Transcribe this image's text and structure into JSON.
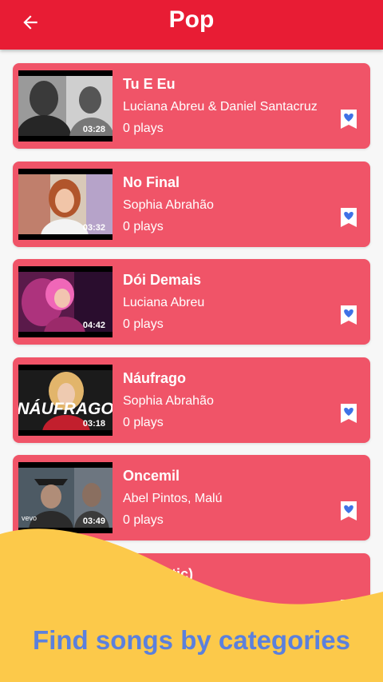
{
  "appbar": {
    "title": "Pop",
    "back_icon": "arrow-left-icon",
    "color": "#e81c34"
  },
  "songs": [
    {
      "title": "Tu E Eu",
      "artist": "Luciana Abreu & Daniel Santacruz",
      "plays": "0 plays",
      "duration": "03:28"
    },
    {
      "title": "No Final",
      "artist": "Sophia Abrahão",
      "plays": "0 plays",
      "duration": "03:32"
    },
    {
      "title": "Dói Demais",
      "artist": "Luciana Abreu",
      "plays": "0 plays",
      "duration": "04:42"
    },
    {
      "title": "Náufrago",
      "artist": "Sophia Abrahão",
      "plays": "0 plays",
      "duration": "03:18",
      "thumb_text": "NÁUFRAGO"
    },
    {
      "title": "Oncemil",
      "artist": "Abel Pintos,  Malú",
      "plays": "0 plays",
      "duration": "03:49",
      "thumb_text": "vevo"
    },
    {
      "title": "(Acoustic)"
    }
  ],
  "card_color": "#f05468",
  "fav_icon": "heart-bookmark-icon",
  "promo": {
    "text": "Find songs by categories",
    "text_color": "#5b80dd",
    "wave_color": "#fcc94a"
  }
}
